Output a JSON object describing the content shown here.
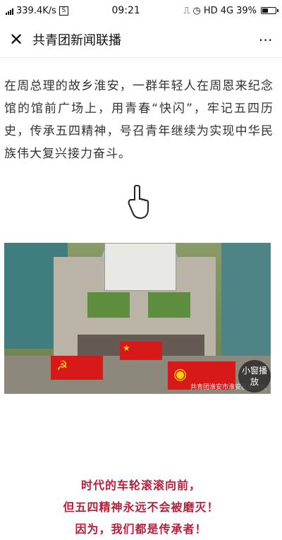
{
  "status_bar": {
    "network_speed": "339.4K/s",
    "notification_badge": "S",
    "time": "09:21",
    "network_type": "HD 4G",
    "battery_percent": "39%"
  },
  "nav": {
    "title": "共青团新闻联播"
  },
  "article": {
    "intro": "在周总理的故乡淮安，一群年轻人在周恩来纪念馆的馆前广场上，用青春“快闪”，牢记五四历史，传承五四精神，号召青年继续为实现中华民族伟大复兴接力奋斗。",
    "photo_overlay_label": "小窗播放",
    "photo_watermark": "共青团淮安市淮安区委员会",
    "slogans": [
      "时代的车轮滚滚向前，",
      "但五四精神永远不会被磨灭！",
      "因为，我们都是传承者！"
    ]
  },
  "colors": {
    "accent": "#b71f3b",
    "flag": "#d71a19"
  },
  "icons": {
    "close": "close-icon",
    "more": "more-icon",
    "pointer": "hand-pointer-icon"
  }
}
